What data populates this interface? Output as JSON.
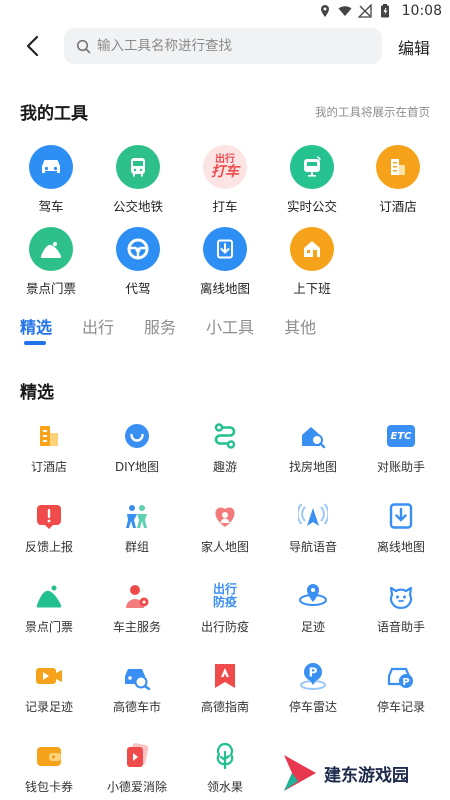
{
  "status_bar": {
    "time": "10:08"
  },
  "top_bar": {
    "search_placeholder": "输入工具名称进行查找",
    "edit_label": "编辑"
  },
  "my_tools": {
    "title": "我的工具",
    "hint": "我的工具将展示在首页",
    "items": [
      {
        "label": "驾车",
        "icon": "car-icon",
        "color": "#2d8ff3"
      },
      {
        "label": "公交地铁",
        "icon": "bus-icon",
        "color": "#2ec08a"
      },
      {
        "label": "打车",
        "icon": "taxi-icon",
        "color": "#ef4b4b"
      },
      {
        "label": "实时公交",
        "icon": "realtime-bus-icon",
        "color": "#26c28f"
      },
      {
        "label": "订酒店",
        "icon": "hotel-icon",
        "color": "#f7a21b"
      },
      {
        "label": "景点门票",
        "icon": "scenic-icon",
        "color": "#2ec08a"
      },
      {
        "label": "代驾",
        "icon": "steering-wheel-icon",
        "color": "#2d8ff3"
      },
      {
        "label": "离线地图",
        "icon": "offline-map-icon",
        "color": "#2d8ff3"
      },
      {
        "label": "上下班",
        "icon": "commute-icon",
        "color": "#f7a21b"
      }
    ],
    "taxi_badge": "打车",
    "taxi_badge_top": "出行"
  },
  "tabs": [
    "精选",
    "出行",
    "服务",
    "小工具",
    "其他"
  ],
  "featured": {
    "title": "精选",
    "items": [
      {
        "label": "订酒店",
        "icon": "hotel-icon"
      },
      {
        "label": "DIY地图",
        "icon": "diy-map-icon"
      },
      {
        "label": "趣游",
        "icon": "route-icon"
      },
      {
        "label": "找房地图",
        "icon": "house-search-icon"
      },
      {
        "label": "对账助手",
        "icon": "etc-icon",
        "badge": "ETC"
      },
      {
        "label": "反馈上报",
        "icon": "feedback-icon"
      },
      {
        "label": "群组",
        "icon": "group-icon"
      },
      {
        "label": "家人地图",
        "icon": "family-map-icon"
      },
      {
        "label": "导航语音",
        "icon": "nav-voice-icon"
      },
      {
        "label": "离线地图",
        "icon": "offline-map-icon"
      },
      {
        "label": "景点门票",
        "icon": "scenic-icon"
      },
      {
        "label": "车主服务",
        "icon": "car-owner-icon"
      },
      {
        "label": "出行防疫",
        "icon": "epidemic-icon",
        "badge_top": "出行",
        "badge_bottom": "防疫"
      },
      {
        "label": "足迹",
        "icon": "footprint-icon"
      },
      {
        "label": "语音助手",
        "icon": "voice-assistant-icon"
      },
      {
        "label": "记录足迹",
        "icon": "record-footprint-icon"
      },
      {
        "label": "高德车市",
        "icon": "car-market-icon"
      },
      {
        "label": "高德指南",
        "icon": "guide-icon"
      },
      {
        "label": "停车雷达",
        "icon": "parking-radar-icon"
      },
      {
        "label": "停车记录",
        "icon": "parking-record-icon"
      },
      {
        "label": "钱包卡券",
        "icon": "wallet-icon"
      },
      {
        "label": "小德爱消除",
        "icon": "game-icon"
      },
      {
        "label": "领水果",
        "icon": "tree-icon"
      }
    ]
  },
  "watermark": {
    "text": "建东游戏园"
  }
}
